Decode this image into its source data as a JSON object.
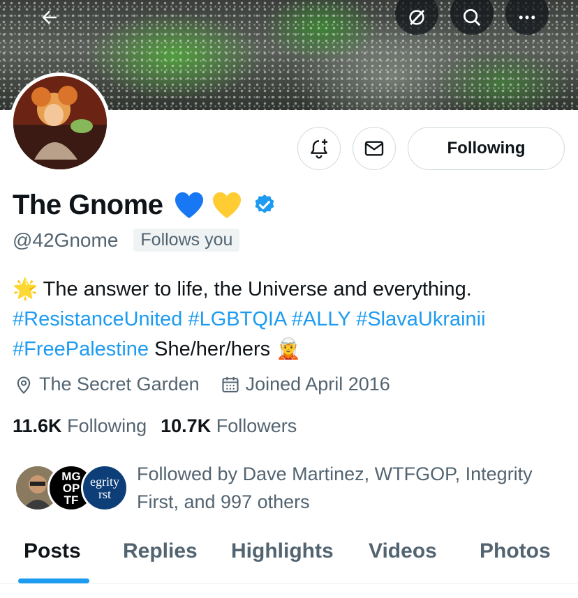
{
  "header": {
    "back_icon": "arrow-left-icon",
    "grok_icon": "grok-icon",
    "search_icon": "search-icon",
    "more_icon": "more-horizontal-icon"
  },
  "actions": {
    "notify_icon": "bell-plus-icon",
    "message_icon": "envelope-icon",
    "following_label": "Following"
  },
  "profile": {
    "display_name": "The Gnome",
    "name_emojis": [
      "blue-heart",
      "yellow-heart"
    ],
    "verified_icon": "verified-badge-icon",
    "handle": "@42Gnome",
    "follows_you": "Follows you",
    "bio": {
      "star_emoji": "🌟",
      "line1": "The answer to life, the Universe and everything.",
      "hashtags_line2": "#ResistanceUnited #LGBTQIA #ALLY #SlavaUkrainii",
      "hashtag_line3": "#FreePalestine",
      "pronouns": "She/her/hers",
      "elf_emoji": "🧝"
    },
    "location": "The Secret Garden",
    "joined": "Joined April 2016",
    "following_count": "11.6K",
    "following_label": "Following",
    "followers_count": "10.7K",
    "followers_label": "Followers",
    "followed_by": "Followed by Dave Martinez, WTFGOP, Integrity First, and 997 others",
    "followed_by_avatars": {
      "wtfgop_text": "MG OP TF",
      "integrity_text": "egrity rst"
    }
  },
  "tabs": [
    {
      "label": "Posts",
      "active": true
    },
    {
      "label": "Replies",
      "active": false
    },
    {
      "label": "Highlights",
      "active": false
    },
    {
      "label": "Videos",
      "active": false
    },
    {
      "label": "Photos",
      "active": false
    }
  ],
  "colors": {
    "accent": "#1d9bf0",
    "text_primary": "#0f1419",
    "text_secondary": "#536471",
    "border": "#cfd9de"
  }
}
